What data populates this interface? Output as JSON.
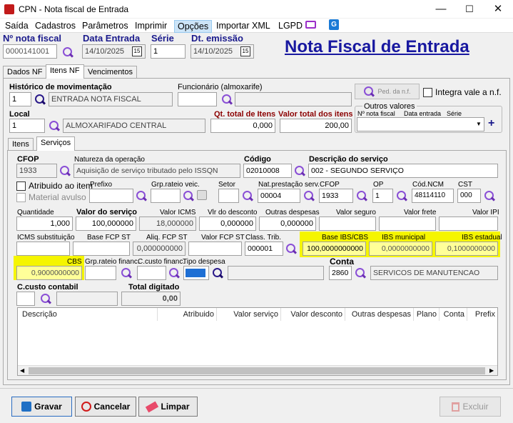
{
  "window": {
    "title": "CPN - Nota fiscal de Entrada",
    "minimize": "—",
    "maximize": "☐",
    "close": "✕"
  },
  "menu": [
    "Saída",
    "Cadastros",
    "Parâmetros",
    "Imprimir",
    "Opções",
    "Importar XML",
    "LGPD"
  ],
  "header": {
    "nf_label": "Nº nota fiscal",
    "nf_value": "0000141001",
    "entrada_label": "Data Entrada",
    "entrada_value": "14/10/2025",
    "serie_label": "Série",
    "serie_value": "1",
    "emissao_label": "Dt. emissão",
    "emissao_value": "14/10/2025",
    "big_title": "Nota Fiscal de Entrada",
    "cal_icon": "15"
  },
  "tabs": [
    "Dados NF",
    "Itens NF",
    "Vencimentos"
  ],
  "itens_nf": {
    "historico_label": "Histórico de movimentação",
    "historico_code": "1",
    "historico_desc": "ENTRADA NOTA FISCAL",
    "funcionario_label": "Funcionário (almoxarife)",
    "funcionario_value": "",
    "ped_button": "Ped. da n.f.",
    "integra_label": "Integra vale a n.f.",
    "local_label": "Local",
    "local_code": "1",
    "local_desc": "ALMOXARIFADO CENTRAL",
    "qt_total_label": "Qt. total de Itens",
    "qt_total_value": "0,000",
    "valor_total_label": "Valor total dos itens",
    "valor_total_value": "200,00",
    "outros_label": "Outros valores",
    "outros_nf_label": "Nº nota fiscal",
    "outros_data_label": "Data entrada",
    "outros_serie_label": "Série",
    "plus": "+"
  },
  "subtabs": [
    "Itens",
    "Serviços"
  ],
  "servicos": {
    "cfop_label": "CFOP",
    "cfop_value": "1933",
    "natureza_label": "Natureza da operação",
    "natureza_value": "Aquisição de serviço tributado pelo ISSQN",
    "codigo_label": "Código",
    "codigo_value": "02010008",
    "descricao_label": "Descrição do serviço",
    "descricao_value": "002 - SEGUNDO SERVIÇO",
    "atribuido_label": "Atribuido ao item",
    "material_label": "Material avulso",
    "prefixo_label": "Prefixo",
    "prefixo_value": "",
    "grp_rateio_label": "Grp.rateio veic.",
    "setor_label": "Setor",
    "nat_prest_label": "Nat.prestação serv.",
    "nat_prest_value": "00004",
    "cfop2_label": "CFOP",
    "cfop2_value": "1933",
    "op_label": "OP",
    "op_value": "1",
    "ncm_label": "Cód.NCM",
    "ncm_value": "48114110",
    "cst_label": "CST",
    "cst_value": "000",
    "quantidade_label": "Quantidade",
    "quantidade_value": "1,000",
    "valor_servico_label": "Valor do serviço",
    "valor_servico_value": "100,000000",
    "valor_icms_label": "Valor ICMS",
    "valor_icms_value": "18,000000",
    "vlr_desconto_label": "Vlr do desconto",
    "vlr_desconto_value": "0,000000",
    "outras_despesas_label": "Outras despesas",
    "outras_despesas_value": "0,000000",
    "valor_seguro_label": "Valor seguro",
    "valor_frete_label": "Valor frete",
    "valor_ipi_label": "Valor IPI",
    "icms_subst_label": "ICMS substituição",
    "base_fcp_label": "Base FCP ST",
    "aliq_fcp_label": "Aliq. FCP ST",
    "aliq_fcp_value": "0,000000000",
    "valor_fcp_label": "Valor FCP ST",
    "class_trib_label": "Class. Trib.",
    "class_trib_value": "000001",
    "base_ibs_label": "Base IBS/CBS",
    "base_ibs_value": "100,0000000000",
    "ibs_mun_label": "IBS municipal",
    "ibs_mun_value": "0,0000000000",
    "ibs_est_label": "IBS estadual",
    "ibs_est_value": "0,1000000000",
    "cbs_label": "CBS",
    "cbs_value": "0,9000000000",
    "grp_fin_label": "Grp.rateio financ.",
    "ccusto_fin_label": "C.custo financ.",
    "tipo_desp_label": "Tipo despesa",
    "conta_label": "Conta",
    "conta_code": "2860",
    "conta_desc": "SERVICOS DE MANUTENCAO",
    "ccusto_cont_label": "C.custo contabil",
    "total_dig_label": "Total digitado",
    "total_dig_value": "0,00"
  },
  "grid_columns": [
    "Descrição",
    "Atribuido",
    "Valor serviço",
    "Valor desconto",
    "Outras despesas",
    "Plano",
    "Conta",
    "Prefix"
  ],
  "buttons": {
    "gravar": "Gravar",
    "cancelar": "Cancelar",
    "limpar": "Limpar",
    "excluir": "Excluir"
  },
  "colors": {
    "title_blue": "#1818a0",
    "highlight": "#f5f500",
    "label_red": "#8b0000"
  }
}
